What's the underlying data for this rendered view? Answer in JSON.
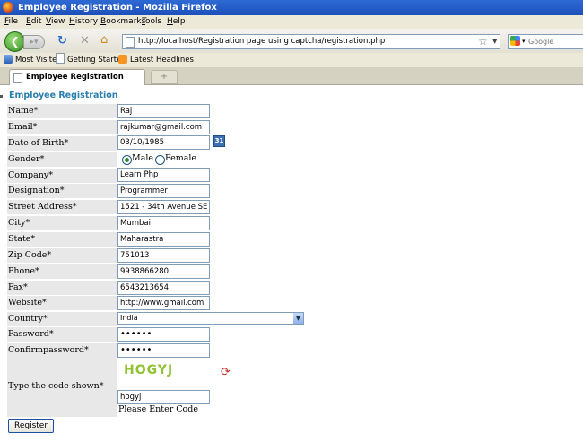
{
  "window": {
    "title": "Employee Registration - Mozilla Firefox"
  },
  "menu": [
    "File",
    "Edit",
    "View",
    "History",
    "Bookmarks",
    "Tools",
    "Help"
  ],
  "nav": {
    "url": "http://localhost/Registration page using captcha/registration.php",
    "search_placeholder": "Google"
  },
  "bookmarks": [
    "Most Visited",
    "Getting Started",
    "Latest Headlines"
  ],
  "tabs": [
    {
      "label": "Employee Registration"
    }
  ],
  "form": {
    "heading": "Employee Registration",
    "fields": [
      {
        "label": "Name*",
        "value": "Raj"
      },
      {
        "label": "Email*",
        "value": "rajkumar@gmail.com"
      },
      {
        "label": "Date of Birth*",
        "value": "03/10/1985"
      },
      {
        "label": "Gender*"
      },
      {
        "label": "Company*",
        "value": "Learn Php"
      },
      {
        "label": "Designation*",
        "value": "Programmer"
      },
      {
        "label": "Street Address*",
        "value": "1521 - 34th Avenue SE"
      },
      {
        "label": "City*",
        "value": "Mumbai"
      },
      {
        "label": "State*",
        "value": "Maharastra"
      },
      {
        "label": "Zip Code*",
        "value": "751013"
      },
      {
        "label": "Phone*",
        "value": "9938866280"
      },
      {
        "label": "Fax*",
        "value": "6543213654"
      },
      {
        "label": "Website*",
        "value": "http://www.gmail.com"
      },
      {
        "label": "Country*",
        "value": "India"
      },
      {
        "label": "Password*",
        "value": "••••••"
      },
      {
        "label": "Confirmpassword*",
        "value": "••••••"
      }
    ],
    "calendar_icon": "31",
    "gender_options": [
      "Male",
      "Female"
    ],
    "gender_selected": "Male",
    "captcha_label": "Type the code shown*",
    "captcha_text": "HOGYJ",
    "captcha_value": "hogyj",
    "captcha_hint": "Please Enter Code",
    "submit_label": "Register"
  },
  "icons": {
    "app": "firefox-icon",
    "back": "back-arrow-icon",
    "forward": "forward-arrow-icon",
    "reload": "reload-icon",
    "stop": "stop-icon",
    "home": "home-icon",
    "bookmark_star": "star-icon",
    "calendar": "calendar-icon",
    "captcha_refresh": "refresh-icon"
  },
  "colors": {
    "heading": "#2a7fad",
    "captcha": "#8fc332",
    "titlebar": "#2f6ad4"
  }
}
